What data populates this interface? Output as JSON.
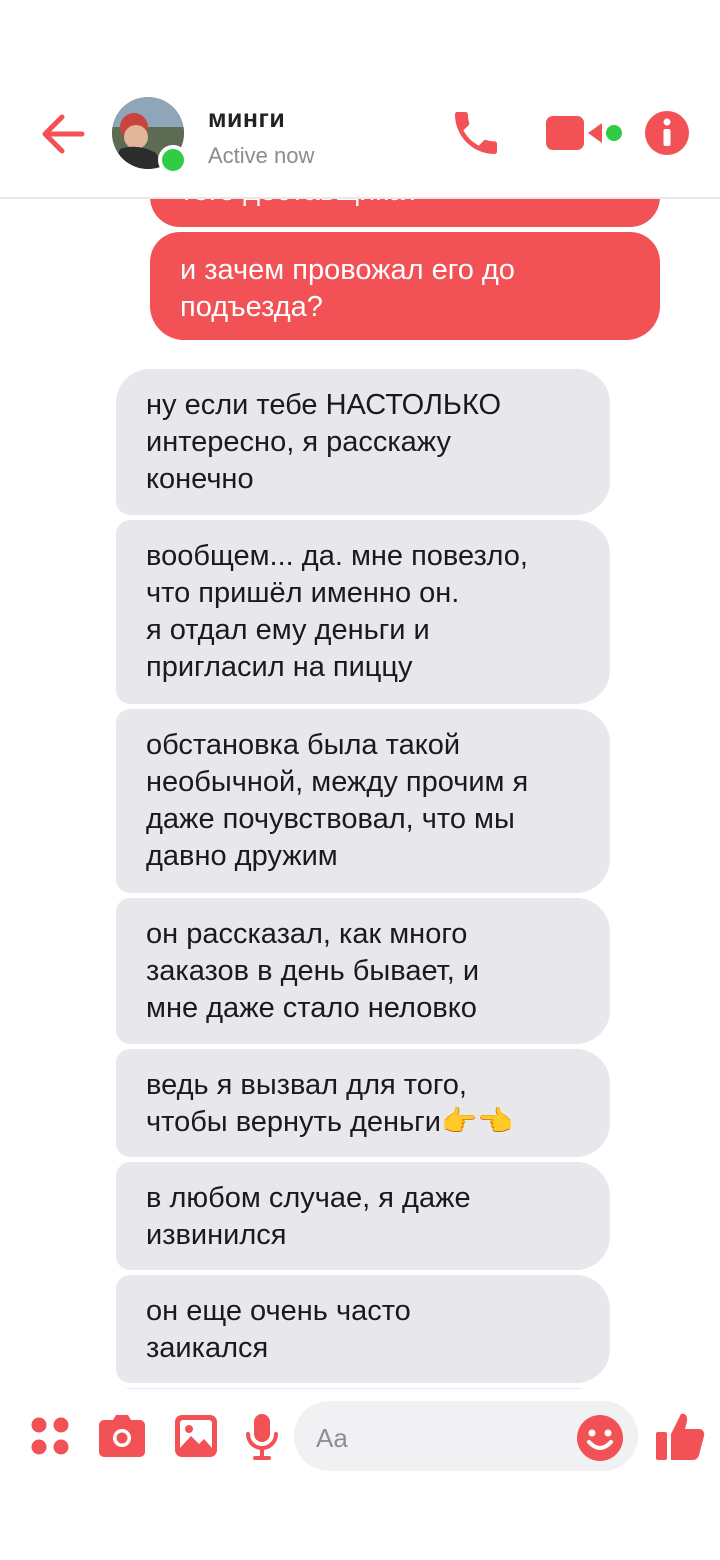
{
  "header": {
    "contact_name": "минги",
    "status": "Active now",
    "icons": [
      "back-arrow-icon",
      "phone-icon",
      "video-camera-icon",
      "info-icon"
    ],
    "accent_color": "#f25155",
    "online_color": "#31cc46"
  },
  "messages": {
    "outgoing": [
      "того доставщика?",
      "и зачем провожал его до\nподъезда?"
    ],
    "incoming": [
      "ну если тебе НАСТОЛЬКО\nинтересно, я расскажу\nконечно",
      "вообщем... да. мне повезло,\nчто пришёл именно он.\nя отдал ему деньги и\nпригласил на пиццу",
      "обстановка была такой\nнеобычной, между прочим я\nдаже почувствовал, что мы\nдавно дружим",
      "он рассказал, как много\nзаказов в день бывает, и\nмне даже стало неловко",
      "ведь я вызвал для того,\nчтобы вернуть деньги👉👈",
      "в любом случае, я даже\nизвинился",
      "он еще очень часто\nзаикался"
    ],
    "incoming_color": "#e8e8ec"
  },
  "composer": {
    "placeholder": "Aa",
    "icons": [
      "apps-grid-icon",
      "camera-icon",
      "image-icon",
      "microphone-icon",
      "emoji-icon",
      "thumbs-up-icon"
    ]
  }
}
